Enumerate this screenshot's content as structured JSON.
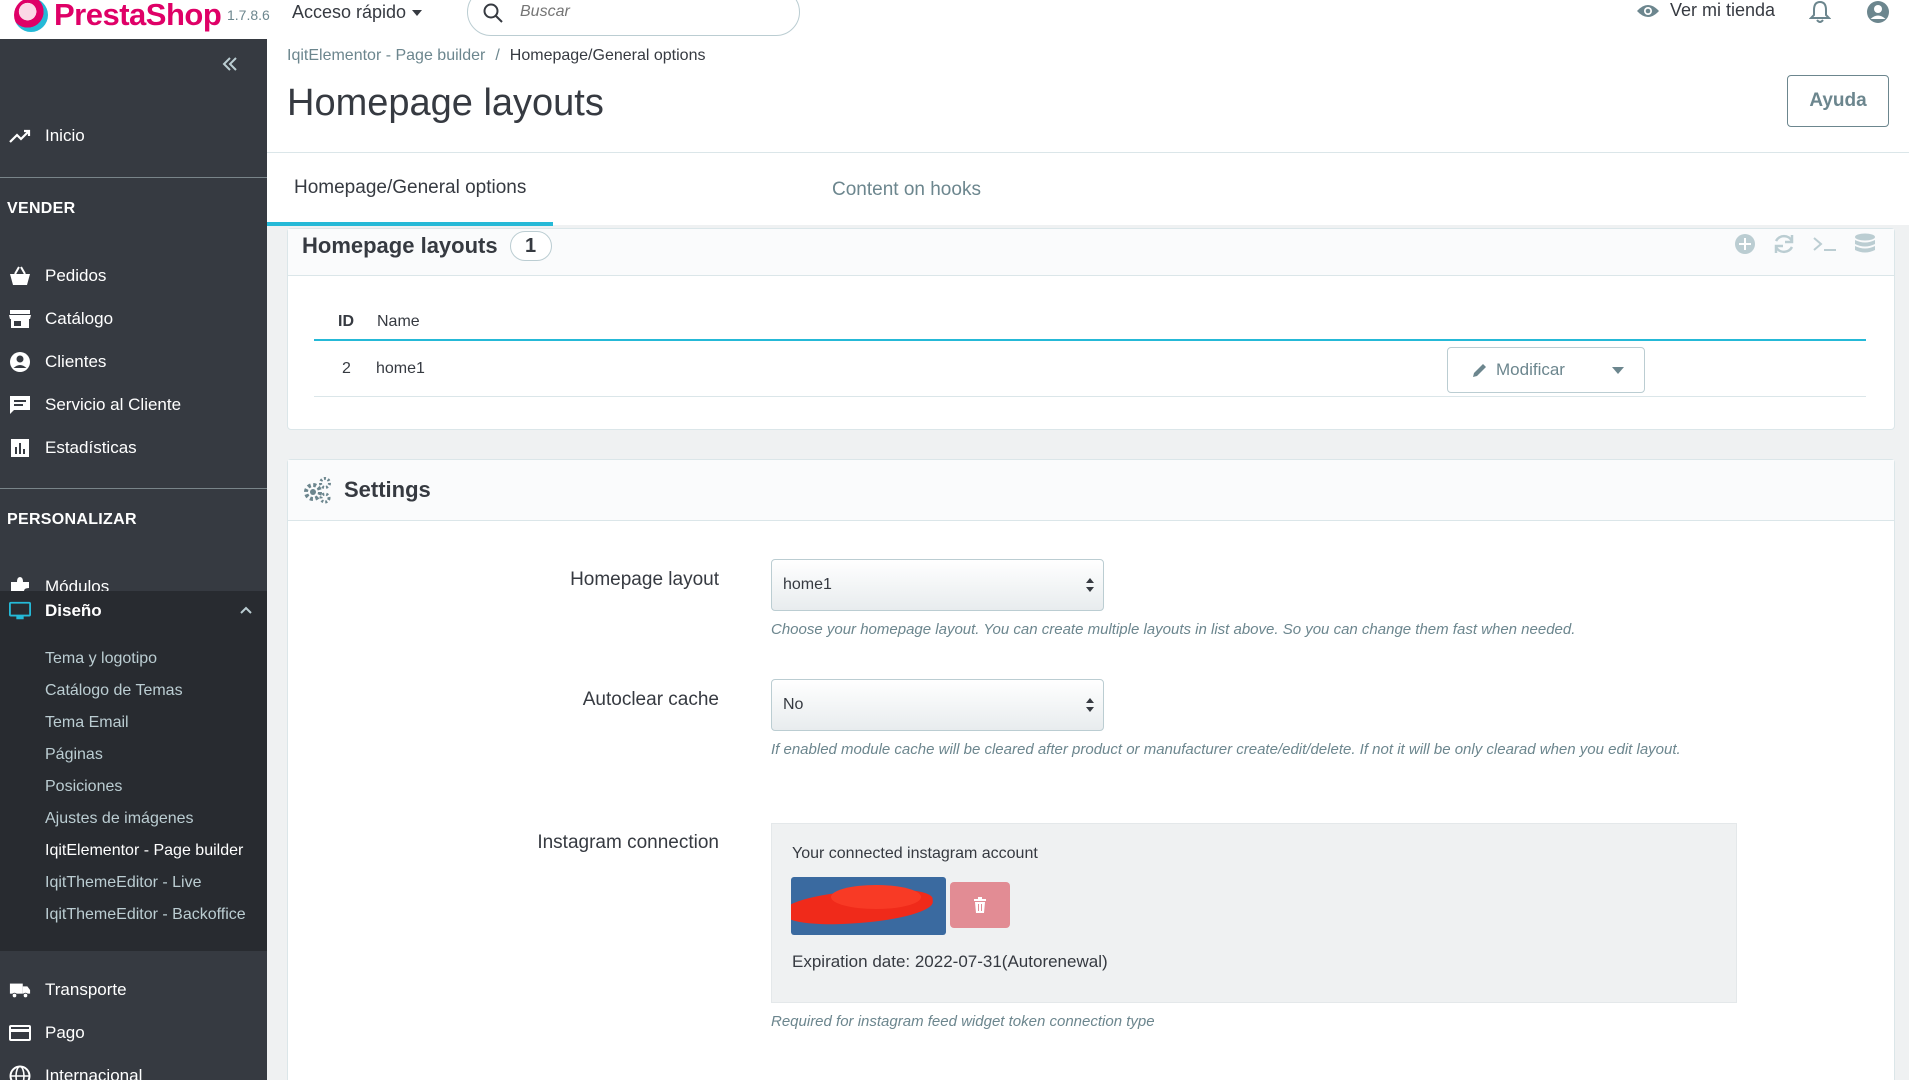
{
  "header": {
    "brand": "PrestaShop",
    "version": "1.7.8.6",
    "quick_access": "Acceso rápido",
    "search_placeholder": "Buscar",
    "view_shop": "Ver mi tienda"
  },
  "sidebar": {
    "home": "Inicio",
    "section_sell": "VENDER",
    "sell_items": [
      "Pedidos",
      "Catálogo",
      "Clientes",
      "Servicio al Cliente",
      "Estadísticas"
    ],
    "section_customize": "PERSONALIZAR",
    "modules": "Módulos",
    "design": "Diseño",
    "design_sub": [
      "Tema y logotipo",
      "Catálogo de Temas",
      "Tema Email",
      "Páginas",
      "Posiciones",
      "Ajustes de imágenes",
      "IqitElementor - Page builder",
      "IqitThemeEditor - Live",
      "IqitThemeEditor - Backoffice"
    ],
    "after_items": [
      "Transporte",
      "Pago",
      "Internacional"
    ]
  },
  "breadcrumb": {
    "parent": "IqitElementor - Page builder",
    "separator": "/",
    "current": "Homepage/General options"
  },
  "page": {
    "title": "Homepage layouts",
    "help_label": "Ayuda"
  },
  "tabs": [
    "Homepage/General options",
    "Content on hooks"
  ],
  "layouts_panel": {
    "title": "Homepage layouts",
    "count": "1",
    "columns": [
      "ID",
      "Name"
    ],
    "rows": [
      {
        "id": "2",
        "name": "home1"
      }
    ],
    "edit_label": "Modificar"
  },
  "settings_panel": {
    "title": "Settings",
    "homepage_layout_label": "Homepage layout",
    "homepage_layout_value": "home1",
    "homepage_layout_help": "Choose your homepage layout. You can create multiple layouts in list above. So you can change them fast when needed.",
    "autoclear_label": "Autoclear cache",
    "autoclear_value": "No",
    "autoclear_help": "If enabled module cache will be cleared after product or manufacturer create/edit/delete. If not it will be only clearad when you edit layout.",
    "instagram_label": "Instagram connection",
    "instagram_title": "Your connected instagram account",
    "instagram_expiration": "Expiration date: 2022-07-31(Autorenewal)",
    "instagram_help": "Required for instagram feed widget token connection type"
  },
  "colors": {
    "accent": "#25b9d7",
    "brand": "#df0067",
    "sidebar_bg": "#363a41",
    "danger_light": "#e28c94"
  }
}
